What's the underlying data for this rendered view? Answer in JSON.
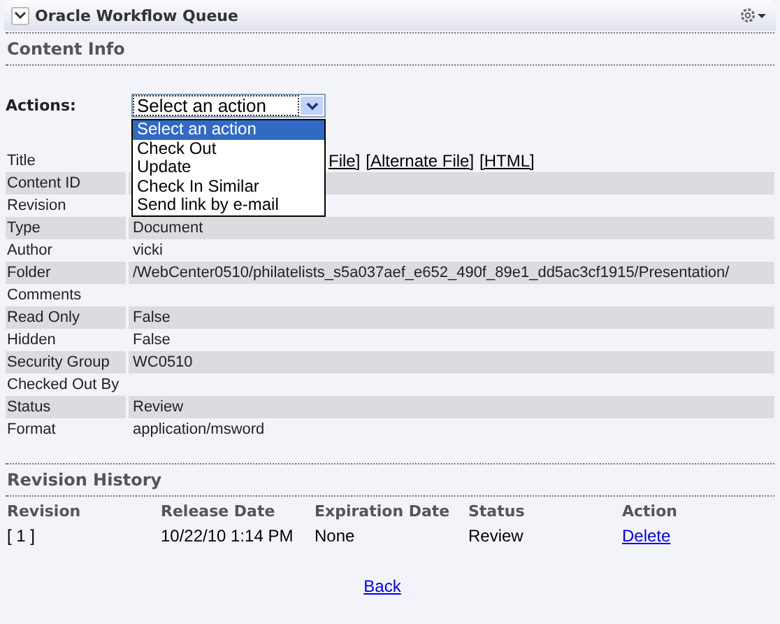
{
  "portlet": {
    "title": "Oracle Workflow Queue"
  },
  "content_info": {
    "heading": "Content Info",
    "actions_label": "Actions:",
    "select": {
      "value": "Select an action",
      "open": true,
      "options": [
        {
          "label": "Select an action",
          "selected": true
        },
        {
          "label": "Check Out",
          "selected": false
        },
        {
          "label": "Update",
          "selected": false
        },
        {
          "label": "Check In Similar",
          "selected": false
        },
        {
          "label": "Send link by e-mail",
          "selected": false
        }
      ]
    },
    "fields": [
      {
        "label": "Title",
        "links": [
          "File]",
          "[Alternate File]",
          "[HTML]"
        ]
      },
      {
        "label": "Content ID"
      },
      {
        "label": "Revision"
      },
      {
        "label": "Type",
        "value": "Document"
      },
      {
        "label": "Author",
        "value": "vicki"
      },
      {
        "label": "Folder",
        "value": "/WebCenter0510/philatelists_s5a037aef_e652_490f_89e1_dd5ac3cf1915/Presentation/"
      },
      {
        "label": "Comments"
      },
      {
        "label": "Read Only",
        "value": "False"
      },
      {
        "label": "Hidden",
        "value": "False"
      },
      {
        "label": "Security Group",
        "value": "WC0510"
      },
      {
        "label": "Checked Out By"
      },
      {
        "label": "Status",
        "value": "Review"
      },
      {
        "label": "Format",
        "value": "application/msword"
      }
    ]
  },
  "revision_history": {
    "heading": "Revision History",
    "columns": [
      "Revision",
      "Release Date",
      "Expiration Date",
      "Status",
      "Action"
    ],
    "rows": [
      {
        "revision": "[ 1 ]",
        "release_date": "10/22/10 1:14 PM",
        "expiration_date": "None",
        "status": "Review",
        "action": "Delete"
      }
    ]
  },
  "back_link": "Back"
}
